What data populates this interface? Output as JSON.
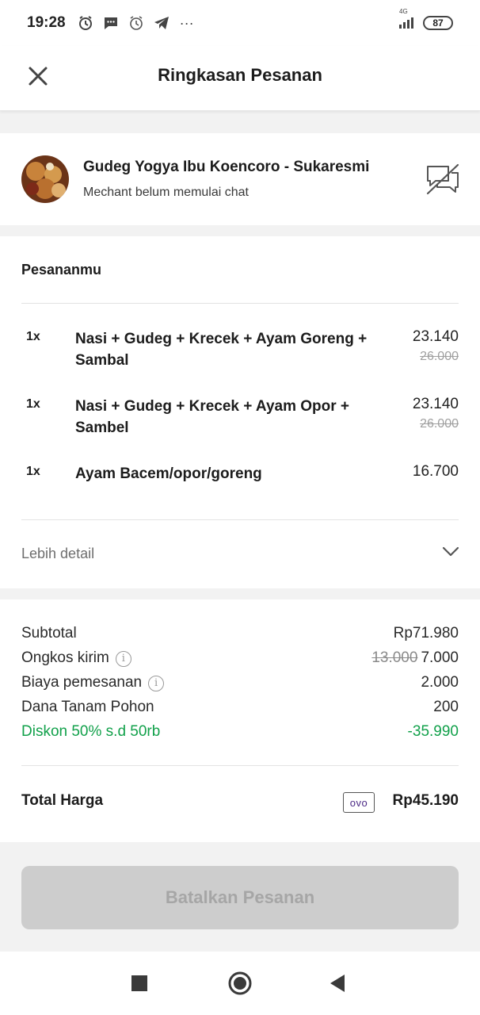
{
  "status_bar": {
    "time": "19:28",
    "network": "4G",
    "battery": "87",
    "more": "···"
  },
  "header": {
    "title": "Ringkasan Pesanan"
  },
  "merchant": {
    "name": "Gudeg Yogya Ibu Koencoro - Sukaresmi",
    "status": "Mechant belum memulai chat"
  },
  "orders": {
    "title": "Pesananmu",
    "items": [
      {
        "qty": "1x",
        "name": "Nasi + Gudeg + Krecek + Ayam Goreng + Sambal",
        "price": "23.140",
        "original_price": "26.000"
      },
      {
        "qty": "1x",
        "name": "Nasi + Gudeg + Krecek + Ayam Opor + Sambel",
        "price": "23.140",
        "original_price": "26.000"
      },
      {
        "qty": "1x",
        "name": "Ayam Bacem/opor/goreng",
        "price": "16.700"
      }
    ],
    "detail_label": "Lebih detail"
  },
  "summary": {
    "subtotal_label": "Subtotal",
    "subtotal_value": "Rp71.980",
    "delivery_label": "Ongkos kirim",
    "delivery_original": "13.000",
    "delivery_value": "7.000",
    "order_fee_label": "Biaya pemesanan",
    "order_fee_value": "2.000",
    "tree_fund_label": "Dana Tanam Pohon",
    "tree_fund_value": "200",
    "discount_label": "Diskon 50% s.d 50rb",
    "discount_value": "-35.990",
    "total_label": "Total Harga",
    "payment_method": "OVO",
    "total_value": "Rp45.190"
  },
  "actions": {
    "cancel_label": "Batalkan Pesanan"
  },
  "colors": {
    "discount_green": "#12a14b",
    "ovo_purple": "#4c2a86",
    "disabled_button": "#cdcdcd"
  }
}
